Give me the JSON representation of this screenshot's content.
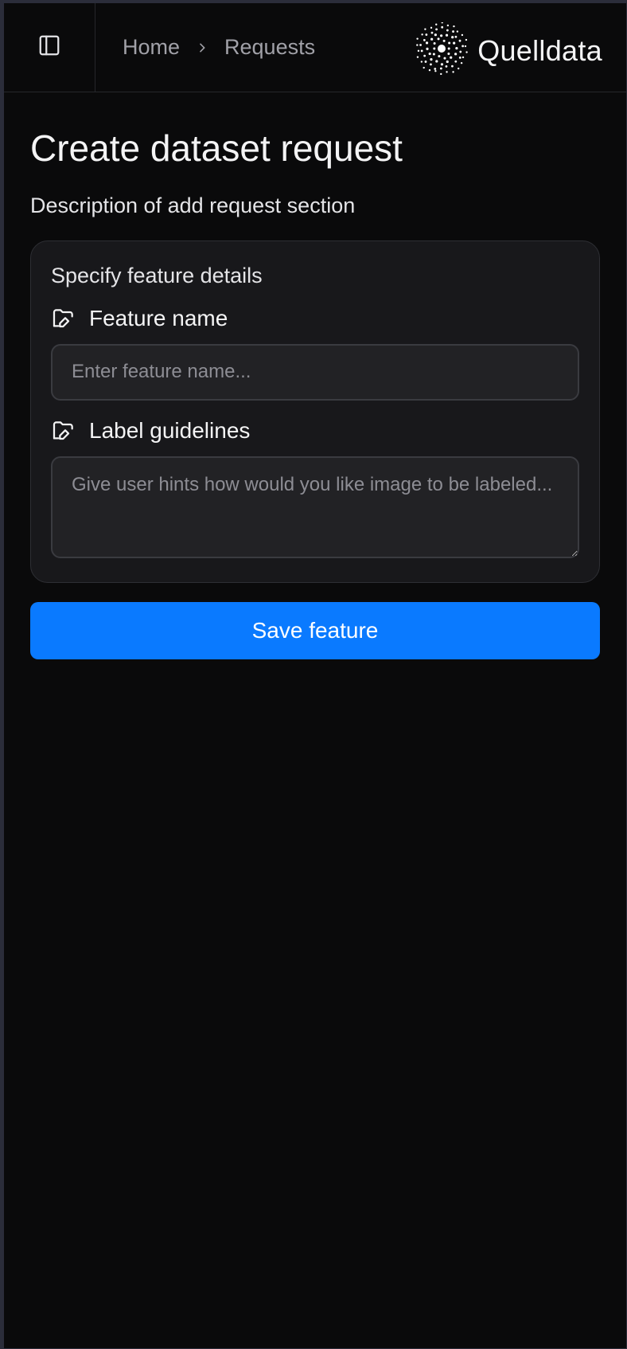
{
  "header": {
    "sidebar_toggle_icon": "sidebar-panel-icon",
    "breadcrumb": [
      {
        "label": "Home"
      },
      {
        "label": "Requests"
      }
    ],
    "breadcrumb_separator_icon": "chevron-right-icon",
    "brand": {
      "name": "Quelldata",
      "logo_icon": "dotted-burst-logo"
    }
  },
  "main": {
    "title": "Create dataset request",
    "description": "Description of add request section",
    "card": {
      "title": "Specify feature details",
      "fields": {
        "feature_name": {
          "label": "Feature name",
          "icon": "folder-edit-icon",
          "placeholder": "Enter feature name...",
          "value": ""
        },
        "label_guidelines": {
          "label": "Label guidelines",
          "icon": "folder-edit-icon",
          "placeholder": "Give user hints how would you like image to be labeled...",
          "value": ""
        }
      }
    },
    "save_button_label": "Save feature"
  },
  "colors": {
    "page_bg": "#0a0a0b",
    "card_bg": "#18181b",
    "accent": "#0a7aff",
    "outer_border": "#2b2d3a"
  }
}
